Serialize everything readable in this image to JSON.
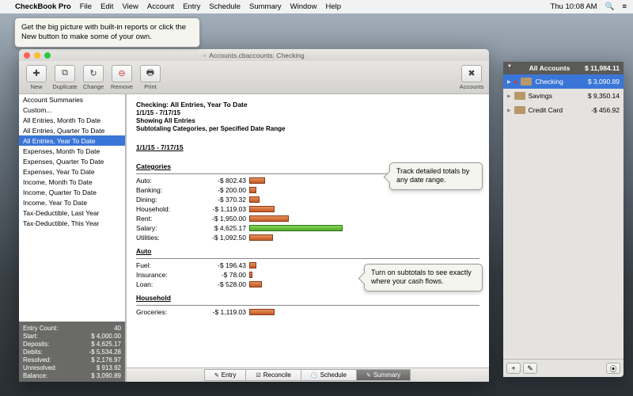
{
  "menubar": {
    "app": "CheckBook Pro",
    "items": [
      "File",
      "Edit",
      "View",
      "Account",
      "Entry",
      "Schedule",
      "Summary",
      "Window",
      "Help"
    ],
    "clock": "Thu 10:08 AM"
  },
  "tooltips": {
    "top": "Get the big picture with built-in reports or click the New button to make some of your own.",
    "c1": "Track detailed totals by any date range.",
    "c2": "Turn on subtotals to see exactly where your cash flows."
  },
  "window": {
    "title": "Accounts.cbaccounts:  Checking",
    "toolbar": [
      {
        "name": "new",
        "label": "New"
      },
      {
        "name": "duplicate",
        "label": "Duplicate"
      },
      {
        "name": "change",
        "label": "Change"
      },
      {
        "name": "remove",
        "label": "Remove"
      },
      {
        "name": "print",
        "label": "Print"
      }
    ],
    "accounts_btn": "Accounts"
  },
  "reports": {
    "list": [
      "Account Summaries",
      "Custom...",
      "All Entries, Month To Date",
      "All Entries, Quarter To Date",
      "All Entries, Year To Date",
      "Expenses, Month To Date",
      "Expenses, Quarter To Date",
      "Expenses, Year To Date",
      "Income, Month To Date",
      "Income, Quarter To Date",
      "Income, Year To Date",
      "Tax-Deductible, Last Year",
      "Tax-Deductible, This Year"
    ],
    "selected_index": 4
  },
  "stats": [
    {
      "k": "Entry Count:",
      "v": "40"
    },
    {
      "k": "Start:",
      "v": "$ 4,000.00"
    },
    {
      "k": "Deposits:",
      "v": "$ 4,625.17"
    },
    {
      "k": "Debits:",
      "v": "-$ 5,534.28"
    },
    {
      "k": "Resolved:",
      "v": "$ 2,176.97"
    },
    {
      "k": "Unresolved:",
      "v": "$ 913.92"
    },
    {
      "k": "Balance:",
      "v": "$ 3,090.89"
    }
  ],
  "report": {
    "heading": "Checking:  All Entries, Year To Date",
    "range": "1/1/15 - 7/17/15",
    "showing": "Showing All Entries",
    "subtotaling": "Subtotaling Categories, per Specified Date Range",
    "sec_range": "1/1/15 - 7/17/15",
    "categories_label": "Categories",
    "categories": [
      {
        "name": "Auto:",
        "value": "-$ 802.43",
        "w": 20,
        "color": "o"
      },
      {
        "name": "Banking:",
        "value": "-$ 200.00",
        "w": 9,
        "color": "o"
      },
      {
        "name": "Dining:",
        "value": "-$ 370.32",
        "w": 13,
        "color": "o"
      },
      {
        "name": "Household:",
        "value": "-$ 1,119.03",
        "w": 32,
        "color": "o"
      },
      {
        "name": "Rent:",
        "value": "-$ 1,950.00",
        "w": 50,
        "color": "o"
      },
      {
        "name": "Salary:",
        "value": "$ 4,625.17",
        "w": 118,
        "color": "g"
      },
      {
        "name": "Utilities:",
        "value": "-$ 1,092.50",
        "w": 30,
        "color": "o"
      }
    ],
    "auto_label": "Auto",
    "auto": [
      {
        "name": "Fuel:",
        "value": "-$ 196.43",
        "w": 9,
        "color": "o"
      },
      {
        "name": "Insurance:",
        "value": "-$ 78.00",
        "w": 4,
        "color": "o"
      },
      {
        "name": "Loan:",
        "value": "-$ 528.00",
        "w": 16,
        "color": "o"
      }
    ],
    "household_label": "Household",
    "household": [
      {
        "name": "Groceries:",
        "value": "-$ 1,119.03",
        "w": 32,
        "color": "o"
      }
    ]
  },
  "tabs": {
    "items": [
      "Entry",
      "Reconcile",
      "Schedule",
      "Summary"
    ],
    "active_index": 3
  },
  "drawer": {
    "header": "All Accounts",
    "total": "$ 11,984.11",
    "accounts": [
      {
        "name": "Checking",
        "amount": "$ 3,090.89",
        "selected": true,
        "alert": true
      },
      {
        "name": "Savings",
        "amount": "$ 9,350.14",
        "selected": false
      },
      {
        "name": "Credit Card",
        "amount": "-$ 456.92",
        "selected": false
      }
    ]
  }
}
